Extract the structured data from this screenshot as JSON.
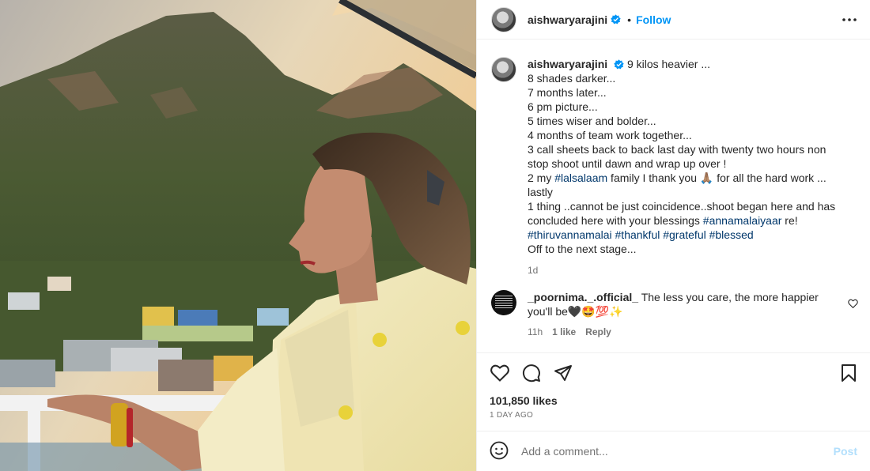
{
  "header": {
    "username": "aishwaryarajini",
    "separator": "•",
    "follow_label": "Follow"
  },
  "caption": {
    "username": "aishwaryarajini",
    "lines": [
      "9 kilos heavier ...",
      "8 shades darker...",
      "7 months later...",
      "6 pm picture...",
      "5 times wiser and bolder...",
      "4 months of team work together...",
      "3 call sheets back to back last day with twenty two hours non stop shoot until dawn and wrap up over !",
      "lastly",
      "Off to the next stage..."
    ],
    "line2_pre": "2 my ",
    "line2_tag": "#lalsalaam",
    "line2_post": " family I thank you 🙏🏽 for all the hard work ...",
    "line1thing_pre": "1 thing ..cannot be just coincidence..shoot began here and has concluded here with your blessings ",
    "line1thing_tag": "#annamalaiyaar",
    "line1thing_post": " re!",
    "tags": [
      "#thiruvannamalai",
      "#thankful",
      "#grateful",
      "#blessed"
    ],
    "time": "1d"
  },
  "comment": {
    "username": "_poornima._.official_",
    "text": "The less you care, the more happier you'll be🖤🤩💯✨",
    "time": "11h",
    "likes": "1 like",
    "reply_label": "Reply"
  },
  "actions": {
    "likes": "101,850 likes",
    "posted": "1 DAY AGO"
  },
  "add_comment": {
    "placeholder": "Add a comment...",
    "post_label": "Post"
  },
  "colors": {
    "accent": "#0095f6",
    "hashtag": "#00376b",
    "muted": "#737373",
    "post_disabled": "#b2dffc"
  },
  "icons": [
    "verified-badge-icon",
    "more-options-icon",
    "heart-icon",
    "comment-icon",
    "share-icon",
    "bookmark-icon",
    "emoji-icon"
  ]
}
